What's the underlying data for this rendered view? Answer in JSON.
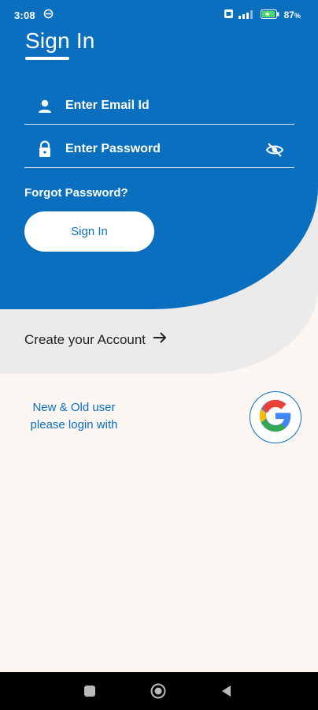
{
  "status_bar": {
    "time": "3:08",
    "battery_percent": "87",
    "battery_suffix": "%"
  },
  "header": {
    "title": "Sign In"
  },
  "form": {
    "email_placeholder": "Enter Email Id",
    "password_placeholder": "Enter Password",
    "forgot_label": "Forgot Password?",
    "signin_label": "Sign In"
  },
  "account": {
    "create_label": "Create your Account"
  },
  "google": {
    "line1": "New & Old user",
    "line2": "please login with"
  },
  "icons": {
    "user": "person-icon",
    "lock": "lock-icon",
    "eye": "eye-off-icon",
    "arrow": "arrow-right-icon",
    "google": "google-logo",
    "nav_recent": "square-icon",
    "nav_home": "circle-icon",
    "nav_back": "triangle-back-icon"
  },
  "colors": {
    "primary": "#0a6fbf",
    "grey_band": "#ebebeb",
    "background": "#fbf6f2"
  }
}
